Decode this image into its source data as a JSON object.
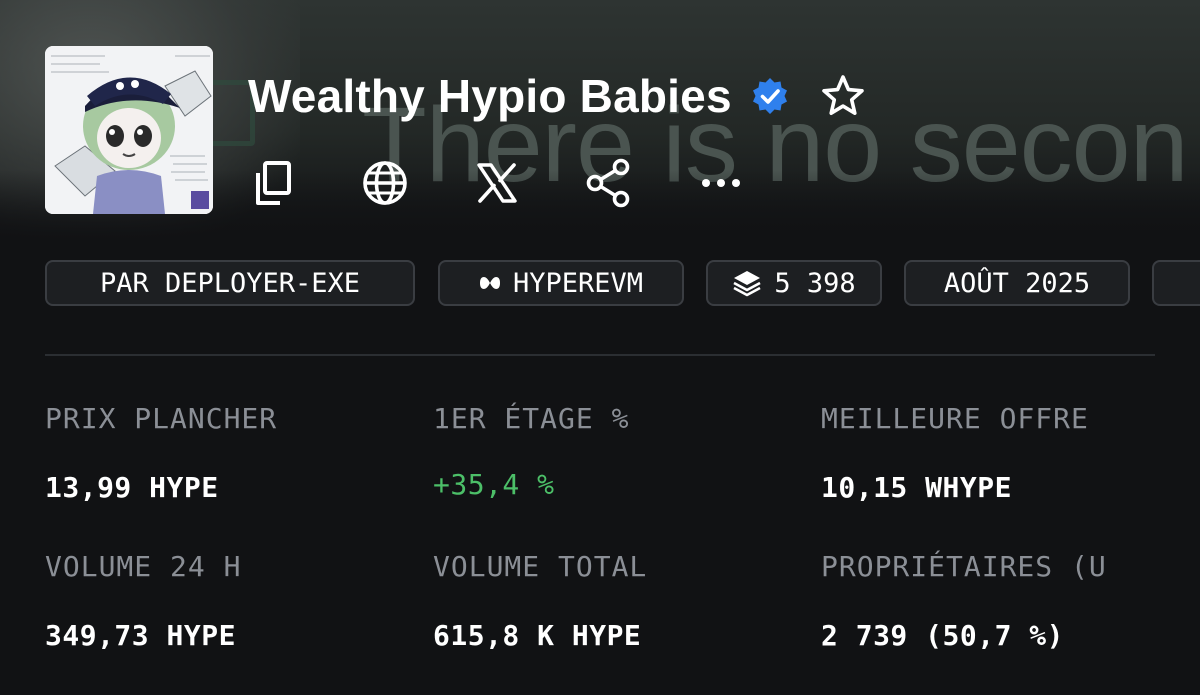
{
  "banner": {
    "background_text": "There is no secon"
  },
  "collection": {
    "name": "Wealthy Hypio Babies",
    "verified": true,
    "favorite": false,
    "avatar": "pixel-character-with-cap"
  },
  "actions": [
    {
      "name": "copy",
      "icon": "copy-icon"
    },
    {
      "name": "website",
      "icon": "globe-icon"
    },
    {
      "name": "x",
      "icon": "x-logo-icon"
    },
    {
      "name": "share",
      "icon": "share-icon"
    },
    {
      "name": "more",
      "icon": "more-dots-icon"
    }
  ],
  "tags": {
    "creator": "PAR DEPLOYER-EXE",
    "chain": "HYPEREVM",
    "supply": "5 398",
    "date": "AOÛT 2025"
  },
  "stats": {
    "floor_price": {
      "label": "PRIX PLANCHER",
      "value": "13,99 HYPE"
    },
    "first_floor": {
      "label": "1ER ÉTAGE %",
      "value": "+35,4 %"
    },
    "best_offer": {
      "label": "MEILLEURE OFFRE",
      "value": "10,15 WHYPE"
    },
    "volume_24h": {
      "label": "VOLUME 24 H",
      "value": "349,73 HYPE"
    },
    "volume_total": {
      "label": "VOLUME TOTAL",
      "value": "615,8 K HYPE"
    },
    "owners": {
      "label": "PROPRIÉTAIRES (U",
      "value": "2 739 (50,7 %)"
    }
  },
  "colors": {
    "background": "#111214",
    "positive": "#4cbf68",
    "verified": "#2f80ed",
    "label": "#8b8f96"
  }
}
